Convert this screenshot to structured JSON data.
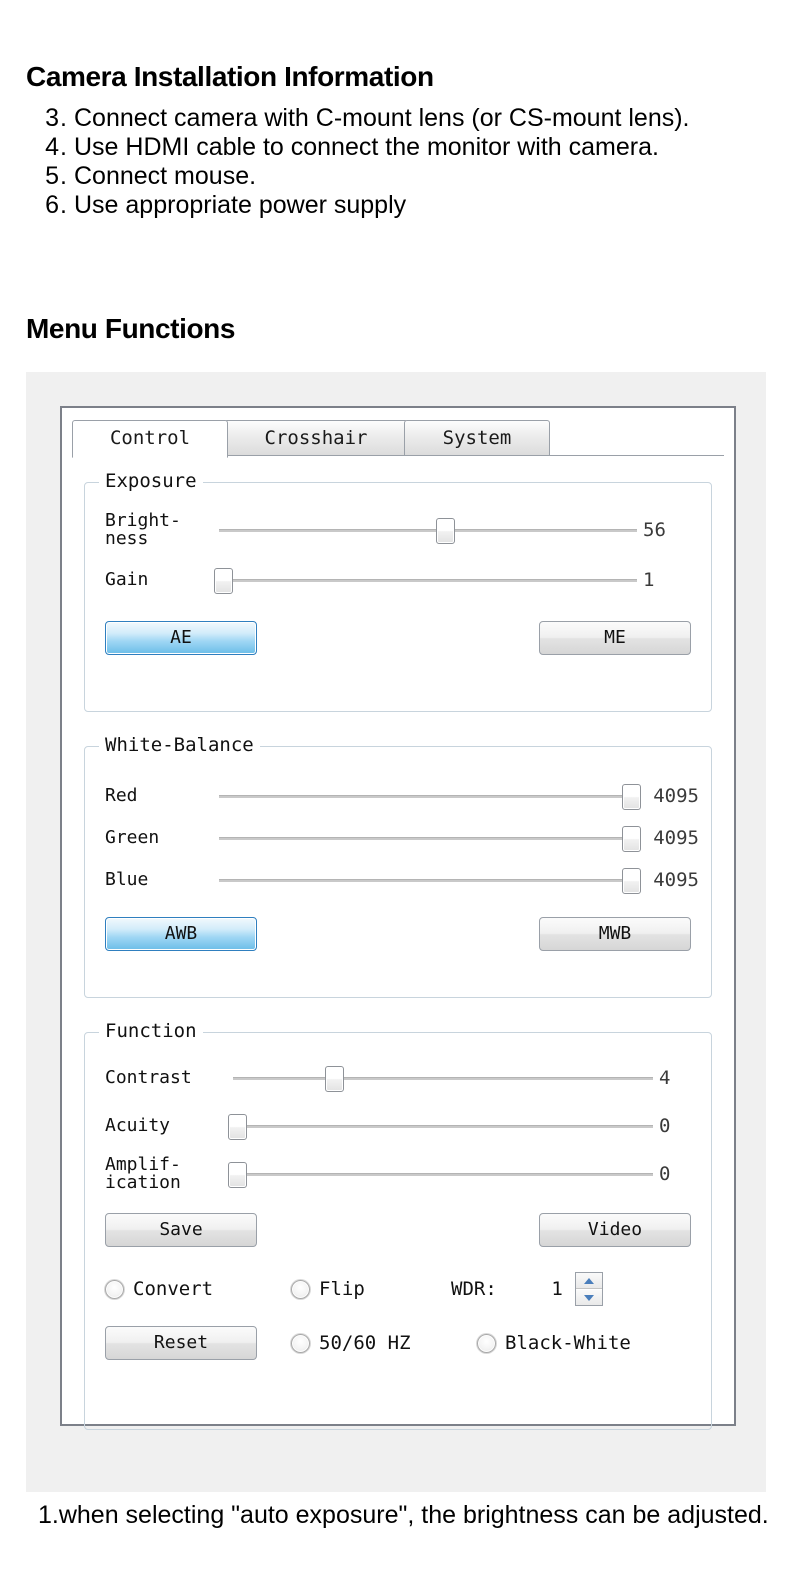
{
  "document": {
    "heading_install": "Camera Installation Information",
    "heading_menu": "Menu Functions",
    "steps": [
      {
        "num": "3.",
        "text": "Connect   camera with C-mount lens (or CS-mount lens)."
      },
      {
        "num": "4.",
        "text": "Use HDMI cable to connect the monitor with camera."
      },
      {
        "num": "5.",
        "text": "Connect mouse."
      },
      {
        "num": "6.",
        "text": "Use appropriate power supply"
      }
    ],
    "footer_note": "1.when selecting \"auto exposure\", the brightness can be adjusted."
  },
  "dialog": {
    "tabs": [
      {
        "label": "Control",
        "active": true
      },
      {
        "label": "Crosshair",
        "active": false
      },
      {
        "label": "System",
        "active": false
      }
    ],
    "exposure": {
      "title": "Exposure",
      "sliders": [
        {
          "label": "Bright-\nness",
          "value": "56",
          "percent": 54
        },
        {
          "label": "Gain",
          "value": "1",
          "percent": 1
        }
      ],
      "buttons": [
        {
          "label": "AE",
          "style": "primary"
        },
        {
          "label": "ME",
          "style": "normal"
        }
      ]
    },
    "white_balance": {
      "title": "White-Balance",
      "sliders": [
        {
          "label": "Red",
          "value": "4095",
          "percent": 100
        },
        {
          "label": "Green",
          "value": "4095",
          "percent": 100
        },
        {
          "label": "Blue",
          "value": "4095",
          "percent": 100
        }
      ],
      "buttons": [
        {
          "label": "AWB",
          "style": "primary"
        },
        {
          "label": "MWB",
          "style": "normal"
        }
      ]
    },
    "function": {
      "title": "Function",
      "sliders": [
        {
          "label": "Contrast",
          "value": "4",
          "percent": 24
        },
        {
          "label": "Acuity",
          "value": "0",
          "percent": 1
        },
        {
          "label": "Amplif-\nication",
          "value": "0",
          "percent": 1
        }
      ],
      "buttons": [
        {
          "label": "Save",
          "style": "normal"
        },
        {
          "label": "Video",
          "style": "normal"
        }
      ],
      "options_row_1": {
        "convert_label": "Convert",
        "convert_selected": false,
        "flip_label": "Flip",
        "flip_selected": false,
        "wdr_label": "WDR:",
        "wdr_value": "1"
      },
      "options_row_2": {
        "reset_label": "Reset",
        "hz_label": "50/60 HZ",
        "hz_selected": false,
        "bw_label": "Black-White",
        "bw_selected": false
      }
    }
  },
  "colors": {
    "panel_bg": "#f0f0f0",
    "dialog_border": "#7c8089",
    "group_border": "#c8d4dd",
    "accent_blue": "#6bbde8",
    "spinner_arrow": "#4a7ebb"
  }
}
